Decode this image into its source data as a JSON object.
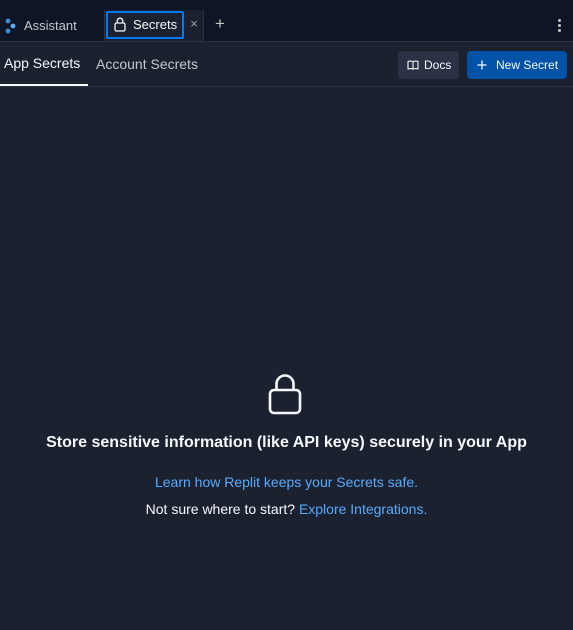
{
  "tabs": {
    "assistant_label": "Assistant",
    "secrets_label": "Secrets",
    "close_symbol": "×",
    "add_symbol": "+"
  },
  "subtabs": {
    "app_secrets": "App Secrets",
    "account_secrets": "Account Secrets"
  },
  "toolbar": {
    "docs_label": "Docs",
    "new_secret_label": "New Secret"
  },
  "empty_state": {
    "title": "Store sensitive information (like API keys) securely in your App",
    "learn_link": "Learn how Replit keeps your Secrets safe.",
    "start_prompt": "Not sure where to start?",
    "explore_link": "Explore Integrations."
  },
  "icons": {
    "assistant": "assistant-icon",
    "lock": "lock-icon",
    "close": "close-icon",
    "add": "plus-icon",
    "menu": "kebab-menu-icon",
    "docs": "book-icon",
    "new": "plus-icon"
  },
  "colors": {
    "background": "#1c2130",
    "tabbar": "#0e1525",
    "accent_blue": "#0079f2",
    "primary_button": "#0053a6",
    "link": "#57abff",
    "text": "#f5f9fc"
  }
}
